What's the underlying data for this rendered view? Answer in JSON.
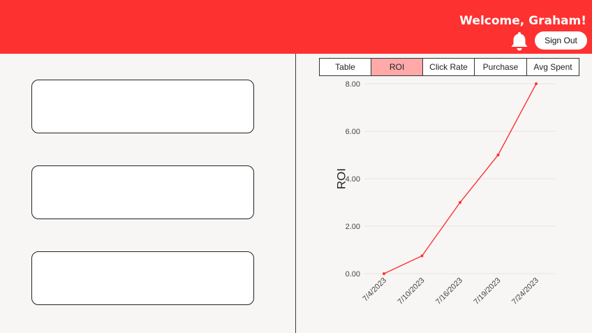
{
  "header": {
    "welcome": "Welcome, Graham!",
    "sign_out_label": "Sign Out",
    "bell_icon": "bell-icon",
    "background_color": "#fe3131"
  },
  "cards": [
    "",
    "",
    ""
  ],
  "tabs": [
    {
      "label": "Table",
      "active": false
    },
    {
      "label": "ROI",
      "active": true
    },
    {
      "label": "Click Rate",
      "active": false
    },
    {
      "label": "Purchase",
      "active": false
    },
    {
      "label": "Avg Spent",
      "active": false
    }
  ],
  "chart_data": {
    "type": "line",
    "ylabel": "ROI",
    "xlabel": "",
    "categories": [
      "7/4/2023",
      "7/10/2023",
      "7/16/2023",
      "7/19/2023",
      "7/24/2023"
    ],
    "series": [
      {
        "values": [
          0.0,
          0.75,
          3.0,
          5.0,
          8.0
        ],
        "color": "#fe3131"
      }
    ],
    "ylim": [
      0,
      8
    ],
    "yticks": [
      "0.00",
      "2.00",
      "4.00",
      "6.00",
      "8.00"
    ],
    "grid": true
  }
}
